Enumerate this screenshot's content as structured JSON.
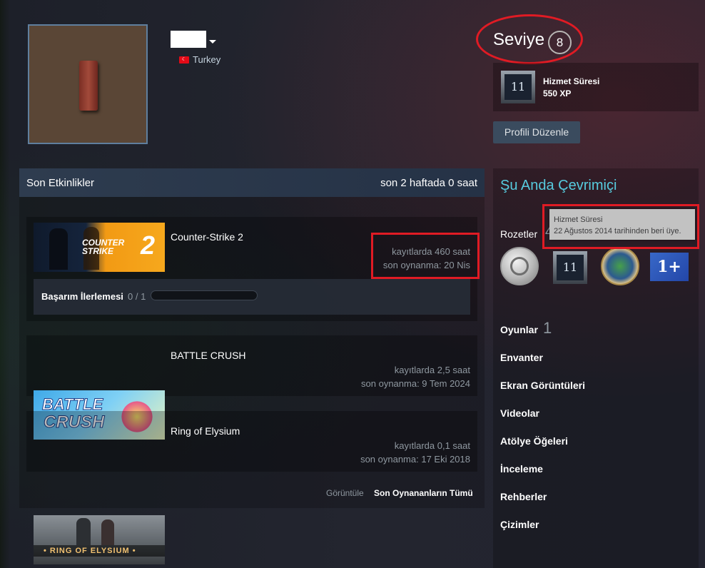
{
  "profile": {
    "country": "Turkey",
    "flag_glyph": "☾"
  },
  "level": {
    "label": "Seviye",
    "value": "8"
  },
  "featured_badge": {
    "title": "Hizmet Süresi",
    "xp": "550 XP",
    "icon_text": "11"
  },
  "edit_profile_label": "Profili Düzenle",
  "activity": {
    "title": "Son Etkinlikler",
    "summary": "son 2 haftada 0 saat",
    "games": [
      {
        "name": "Counter-Strike 2",
        "hours": "kayıtlarda 460 saat",
        "last_played": "son oynanma: 20 Nis",
        "thumb_line1": "COUNTER",
        "thumb_line2": "STRIKE",
        "thumb_num": "2"
      },
      {
        "name": "BATTLE CRUSH",
        "hours": "kayıtlarda 2,5 saat",
        "last_played": "son oynanma: 9 Tem 2024",
        "thumb_line1": "BATTLE",
        "thumb_line2": "CRUSH"
      },
      {
        "name": "Ring of Elysium",
        "hours": "kayıtlarda 0,1 saat",
        "last_played": "son oynanma: 17 Eki 2018",
        "thumb_line1": "• RING OF ELYSIUM •"
      }
    ],
    "achievement": {
      "label": "Başarım İlerlemesi",
      "count": "0 / 1",
      "progress": 0
    },
    "view_label": "Görüntüle",
    "view_all_label": "Son Oynananların Tümü"
  },
  "sidebar": {
    "online_status": "Şu Anda Çevrimiçi",
    "badges_label": "Rozetler",
    "badges_count": "4",
    "tooltip": {
      "title": "Hizmet Süresi",
      "text": "22 Ağustos 2014 tarihinden beri üye."
    },
    "badge_icons": [
      "coin-badge-icon",
      "years-of-service-badge-icon",
      "game-collector-badge-icon",
      "one-plus-badge-icon"
    ],
    "badge2_text": "11",
    "badge4_text": "1+",
    "games_label": "Oyunlar",
    "games_count": "1",
    "links": [
      "Envanter",
      "Ekran Görüntüleri",
      "Videolar",
      "Atölye Öğeleri",
      "İnceleme",
      "Rehberler",
      "Çizimler"
    ]
  },
  "colors": {
    "online": "#57cbde",
    "highlight": "#e01b24"
  }
}
